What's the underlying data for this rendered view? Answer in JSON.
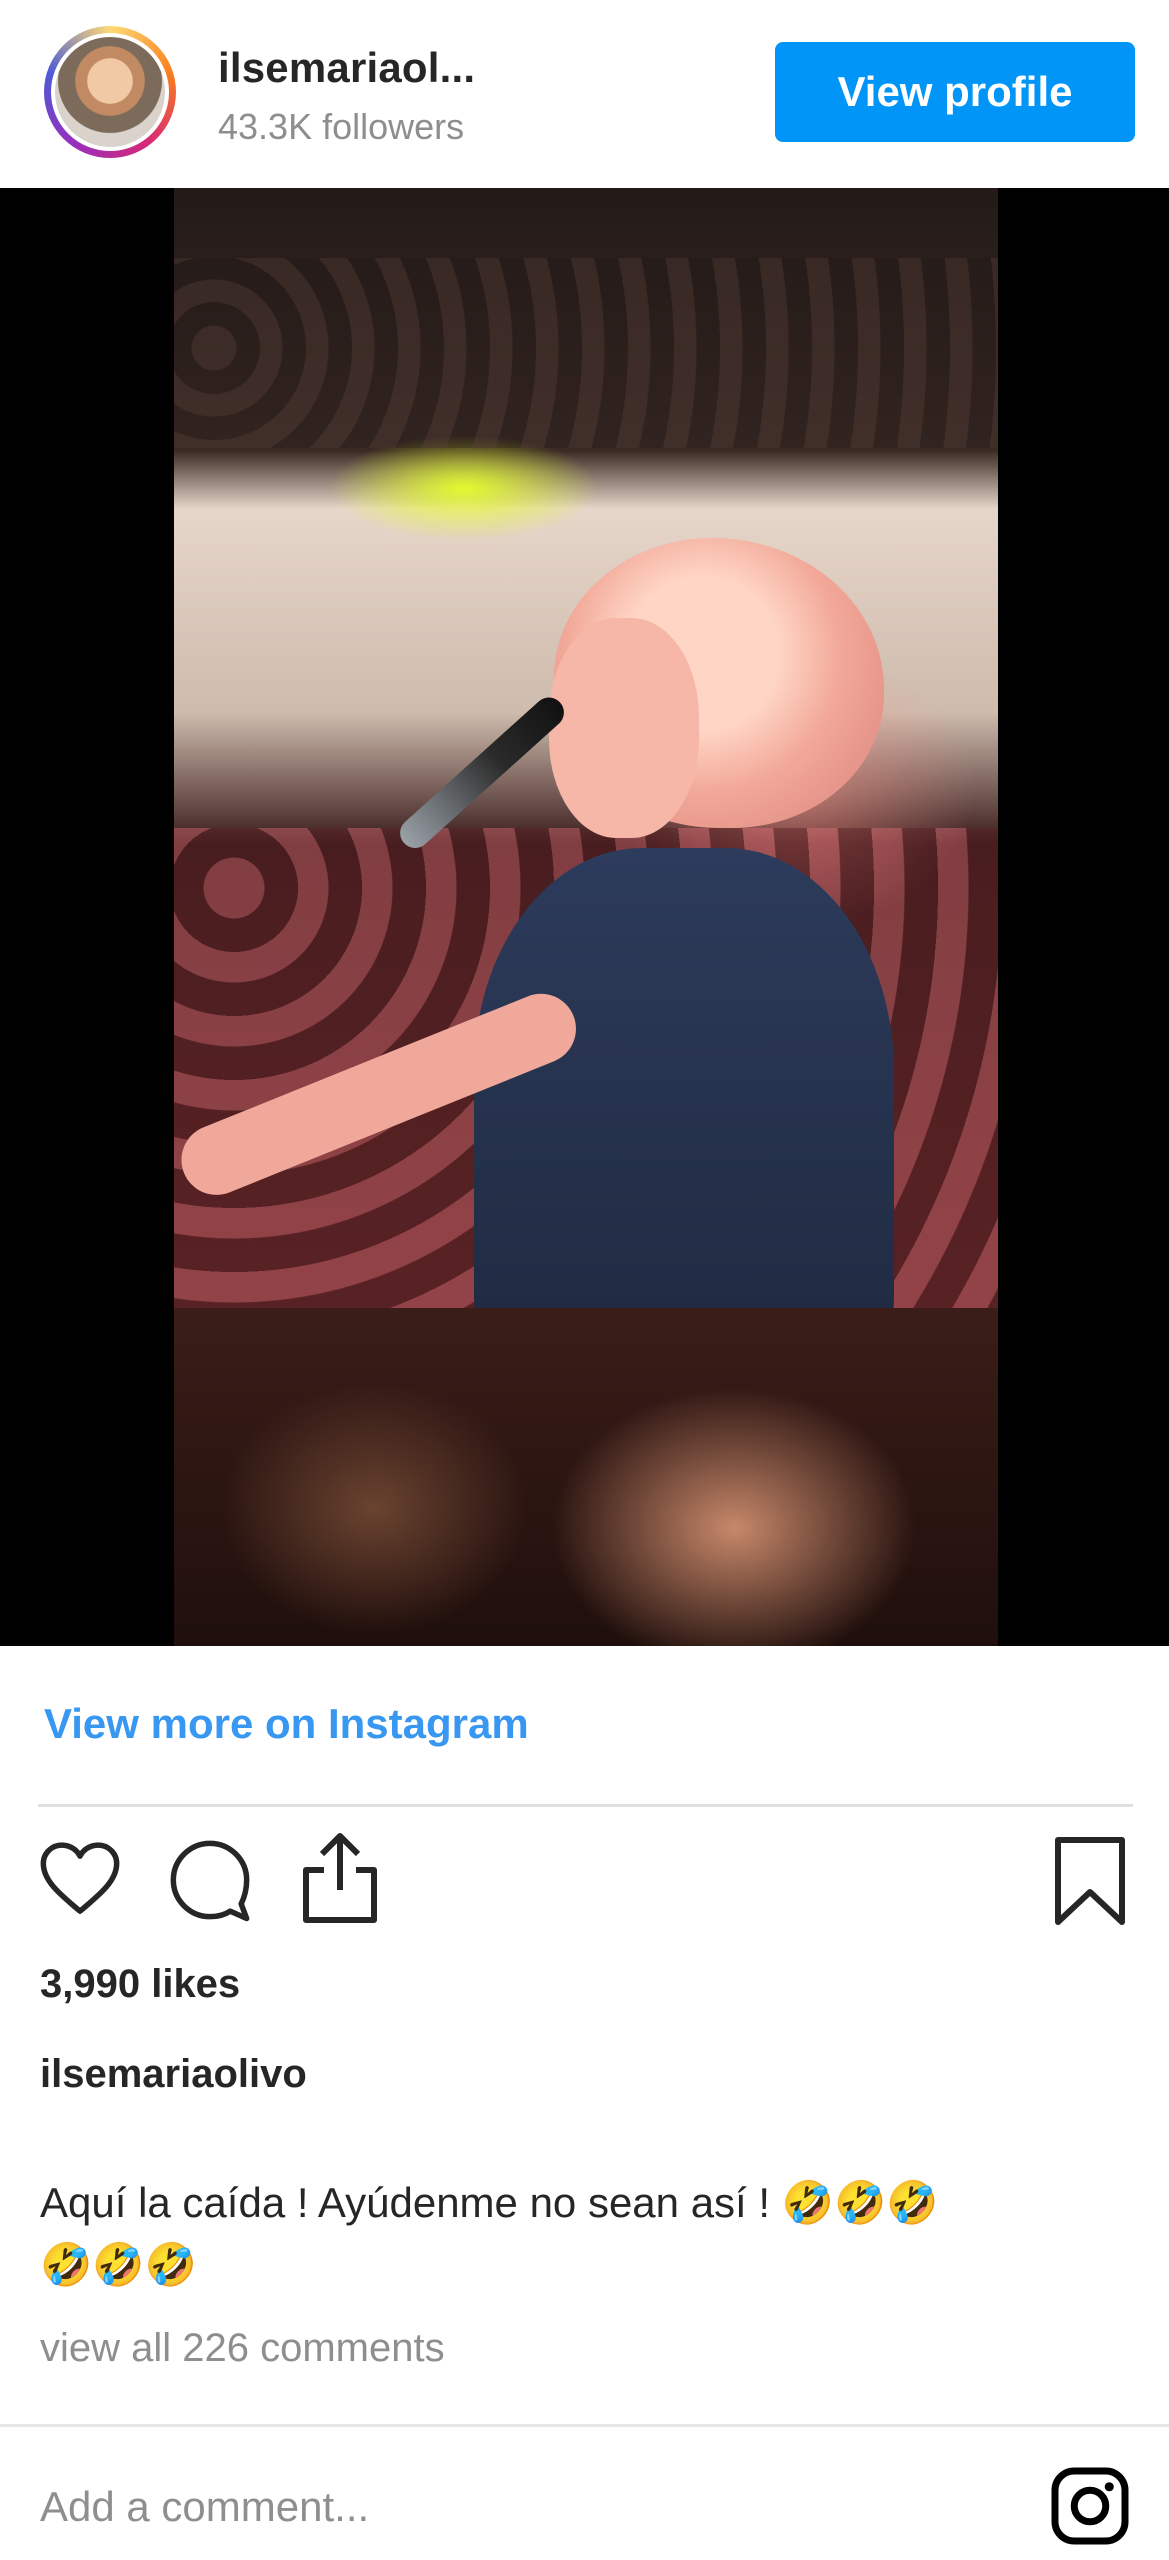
{
  "header": {
    "username": "ilsemariaol...",
    "followers": "43.3K followers",
    "view_profile_label": "View profile"
  },
  "media": {
    "type": "video-still"
  },
  "footer": {
    "view_more_label": "View more on Instagram",
    "likes": "3,990 likes",
    "caption_user": "ilsemariaolivo",
    "caption_text": "Aquí la caída ! Ayúdenme no sean así ! 🤣🤣🤣",
    "caption_emojis_line2": "🤣🤣🤣",
    "view_all_comments": "view all 226 comments",
    "comment_placeholder": "Add a comment..."
  },
  "icons": [
    "heart-icon",
    "comment-icon",
    "share-icon",
    "bookmark-icon",
    "instagram-icon"
  ],
  "colors": {
    "accent": "#0095f6",
    "link": "#3897f0",
    "muted": "#8e8e8e",
    "text": "#262626"
  }
}
